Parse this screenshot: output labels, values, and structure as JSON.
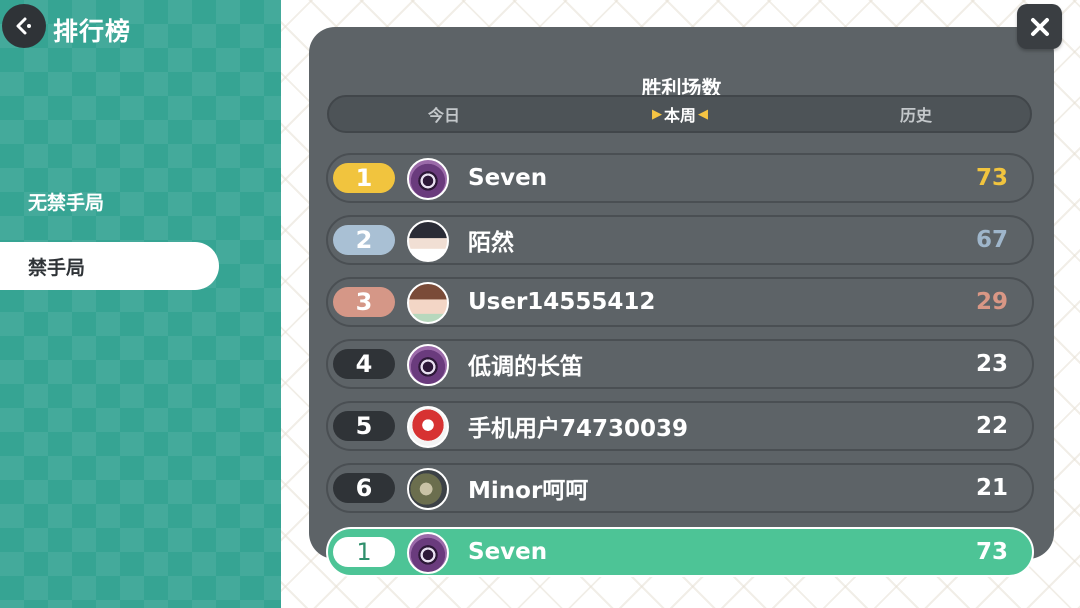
{
  "header": {
    "title": "排行榜"
  },
  "sidebar": {
    "items": [
      {
        "label": "无禁手局",
        "active": false
      },
      {
        "label": "禁手局",
        "active": true
      }
    ]
  },
  "panel": {
    "title": "胜利场数",
    "tabs": [
      {
        "label": "今日",
        "active": false
      },
      {
        "label": "本周",
        "active": true
      },
      {
        "label": "历史",
        "active": false
      }
    ]
  },
  "leaderboard": [
    {
      "rank": "1",
      "name": "Seven",
      "score": "73",
      "avatar": "purple-eye-avatar",
      "tier": "gold"
    },
    {
      "rank": "2",
      "name": "陌然",
      "score": "67",
      "avatar": "anime-boy-avatar",
      "tier": "silver"
    },
    {
      "rank": "3",
      "name": "User14555412",
      "score": "29",
      "avatar": "anime-girl-avatar",
      "tier": "bronze"
    },
    {
      "rank": "4",
      "name": "低调的长笛",
      "score": "23",
      "avatar": "purple-eye-avatar",
      "tier": "normal"
    },
    {
      "rank": "5",
      "name": "手机用户74730039",
      "score": "22",
      "avatar": "red-mask-avatar",
      "tier": "normal"
    },
    {
      "rank": "6",
      "name": "Minor呵呵",
      "score": "21",
      "avatar": "dragon-avatar",
      "tier": "normal"
    }
  ],
  "current_user": {
    "rank": "1",
    "name": "Seven",
    "score": "73",
    "avatar": "purple-eye-avatar"
  },
  "colors": {
    "accent_green": "#4dc496",
    "gold": "#f1c43e",
    "silver": "#a9c0d4",
    "bronze": "#d59787",
    "panel": "#5d6367"
  }
}
